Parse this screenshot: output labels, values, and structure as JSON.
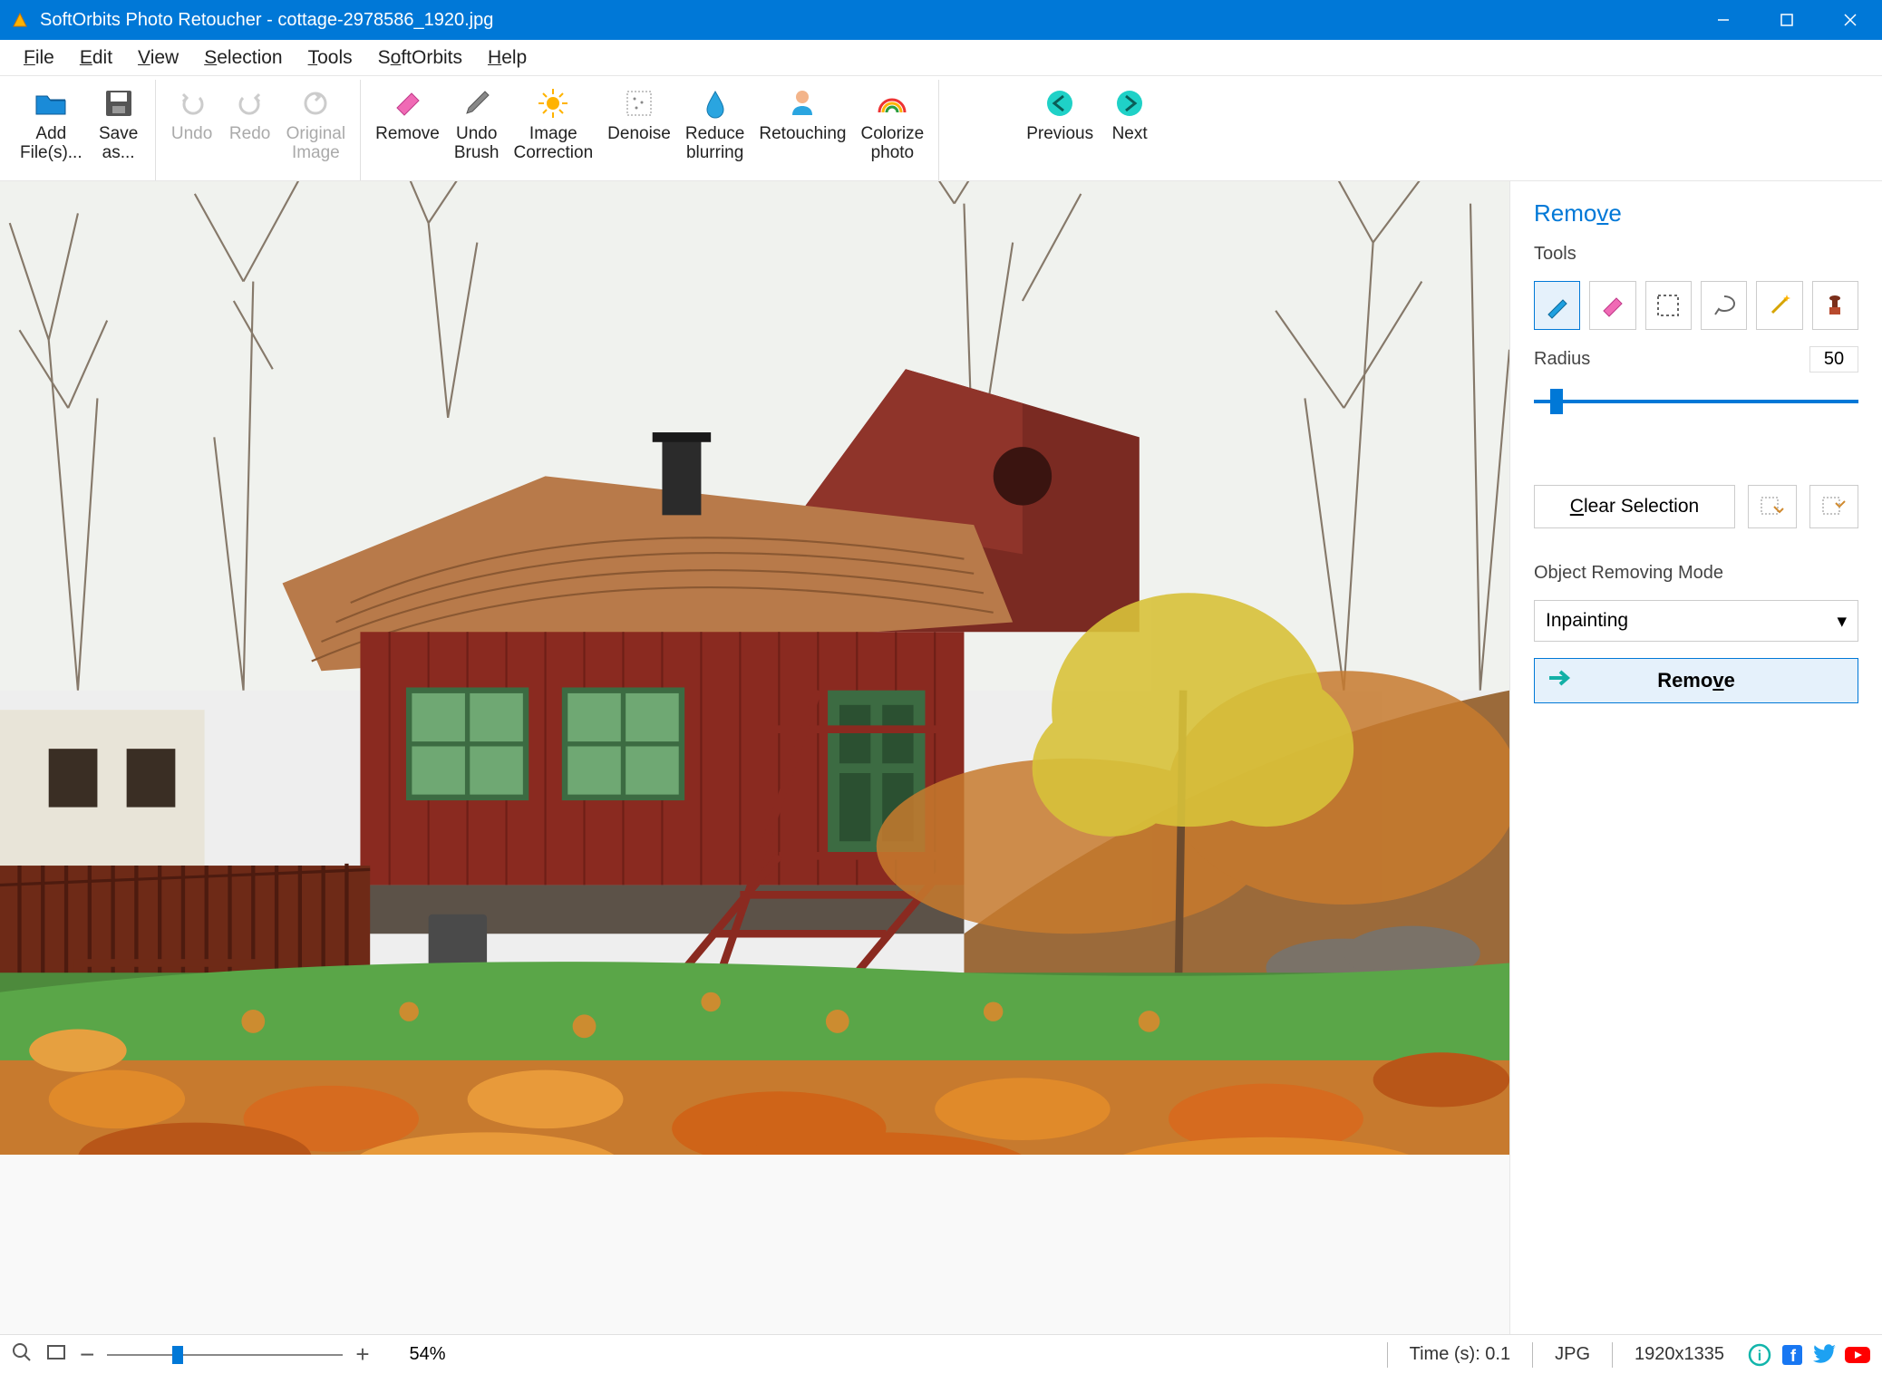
{
  "titlebar": {
    "title": "SoftOrbits Photo Retoucher - cottage-2978586_1920.jpg"
  },
  "menubar": [
    "File",
    "Edit",
    "View",
    "Selection",
    "Tools",
    "SoftOrbits",
    "Help"
  ],
  "toolbar": {
    "add_files": "Add\nFile(s)...",
    "save_as": "Save\nas...",
    "undo": "Undo",
    "redo": "Redo",
    "original": "Original\nImage",
    "remove": "Remove",
    "undo_brush": "Undo\nBrush",
    "image_correction": "Image\nCorrection",
    "denoise": "Denoise",
    "reduce_blurring": "Reduce\nblurring",
    "retouching": "Retouching",
    "colorize": "Colorize\nphoto",
    "previous": "Previous",
    "next": "Next"
  },
  "sidebar": {
    "title": "Remove",
    "tools_label": "Tools",
    "radius_label": "Radius",
    "radius_value": "50",
    "clear_selection": "Clear Selection",
    "object_removing_mode": "Object Removing Mode",
    "mode_value": "Inpainting",
    "remove_btn": "Remove"
  },
  "statusbar": {
    "zoom": "54%",
    "time": "Time (s): 0.1",
    "format": "JPG",
    "dimensions": "1920x1335"
  }
}
